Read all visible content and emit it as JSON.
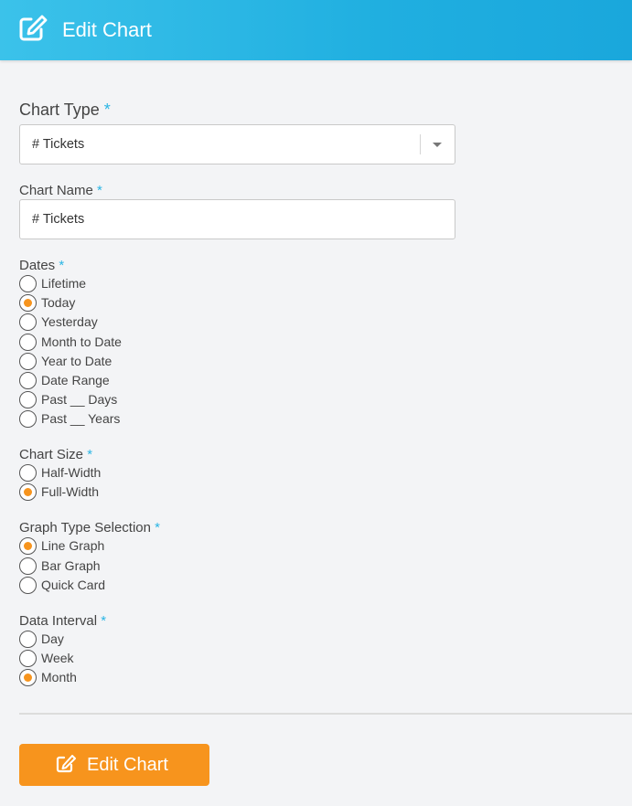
{
  "header": {
    "title": "Edit Chart",
    "icon": "edit-icon"
  },
  "required_marker": "*",
  "chart_type": {
    "label": "Chart Type",
    "value": "# Tickets"
  },
  "chart_name": {
    "label": "Chart Name",
    "value": "# Tickets"
  },
  "dates": {
    "label": "Dates",
    "options": [
      "Lifetime",
      "Today",
      "Yesterday",
      "Month to Date",
      "Year to Date",
      "Date Range",
      "Past __ Days",
      "Past __ Years"
    ],
    "selected": "Today"
  },
  "chart_size": {
    "label": "Chart Size",
    "options": [
      "Half-Width",
      "Full-Width"
    ],
    "selected": "Full-Width"
  },
  "graph_type": {
    "label": "Graph Type Selection",
    "options": [
      "Line Graph",
      "Bar Graph",
      "Quick Card"
    ],
    "selected": "Line Graph"
  },
  "data_interval": {
    "label": "Data Interval",
    "options": [
      "Day",
      "Week",
      "Month"
    ],
    "selected": "Month"
  },
  "submit_button": {
    "label": "Edit Chart",
    "icon": "edit-icon"
  },
  "colors": {
    "header": "#20afe0",
    "accent": "#f7941d",
    "required": "#2ab5e4"
  }
}
